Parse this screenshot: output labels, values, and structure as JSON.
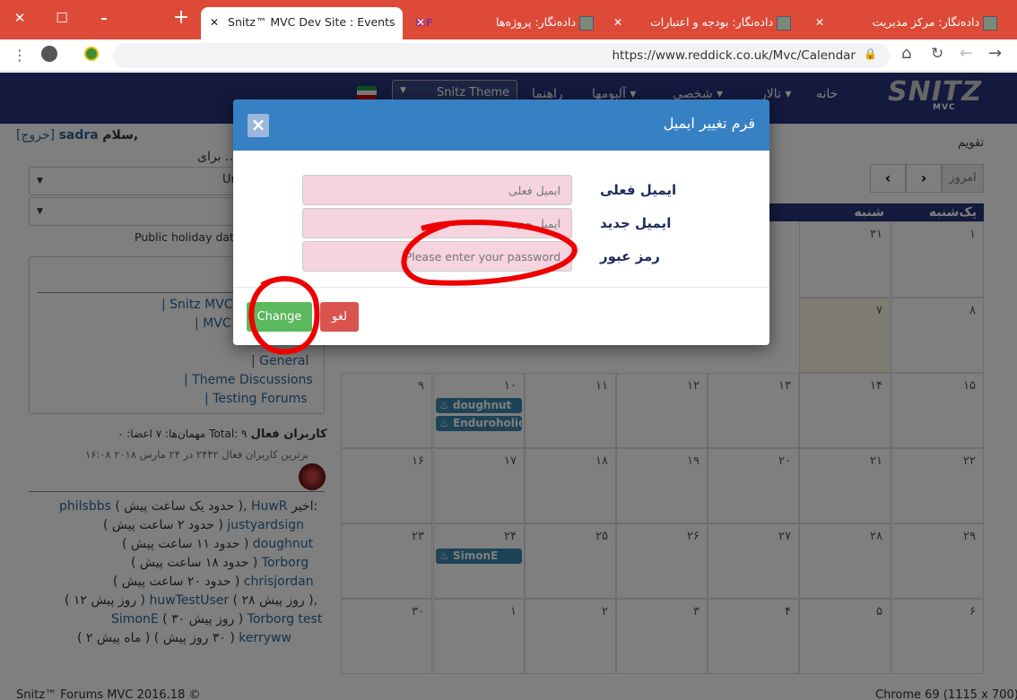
{
  "browser": {
    "tabs": [
      {
        "label": "دادەنگار: مرکز مدیریت"
      },
      {
        "label": "دادەنگار: بودجه و اعتبارات"
      },
      {
        "label": "دادەنگار: پروژه‌ها"
      },
      {
        "label": "Snitz™ MVC Dev Site : Events",
        "badge": "S:F"
      }
    ],
    "new_tab": "+",
    "url": "https://www.reddick.co.uk/Mvc/Calendar"
  },
  "site": {
    "logo": "SNITZ",
    "logo_sub": "MVC",
    "nav": {
      "home": "خانه",
      "forums": "تالار",
      "personal": "شخصی",
      "albums": "آلبومها",
      "guides": "راهنما",
      "theme": "Snitz Theme"
    },
    "greeting": "سلام,",
    "username": "sadra",
    "logout": "[خروج]",
    "calendar_title": "تقویم",
    "filter_label": "برای ..",
    "select1_value": "Un",
    "holiday_text": "Public holiday data",
    "today_btn": "امروز",
    "weekdays": [
      "یک‌شنبه",
      "شنبه"
    ],
    "days": [
      [
        "۱",
        "۳۱"
      ],
      [
        "۸",
        "۷"
      ],
      [
        "۱۵",
        "۱۴",
        "۱۳",
        "۱۲",
        "۱۱",
        "۱۰",
        "۹"
      ],
      [
        "۲۲",
        "۲۱",
        "۲۰",
        "۱۹",
        "۱۸",
        "۱۷",
        "۱۶"
      ],
      [
        "۲۹",
        "۲۸",
        "۲۷",
        "۲۶",
        "۲۵",
        "۲۴",
        "۲۳"
      ],
      [
        "۶",
        "۵",
        "۴",
        "۳",
        "۲",
        "۱",
        "۳۰"
      ]
    ],
    "events": [
      "doughnut",
      "Enduroholic",
      "SimonE"
    ],
    "forums": [
      "Snitz MVC",
      "MVC",
      "General",
      "Theme Discussions",
      "Testing Forums"
    ],
    "active_users": {
      "label": "کاربران فعال",
      "stats": "مهمان‌ها: ۷ اعضا: ۰ Total: ۹",
      "record": "برترین کاربران فعال ۲۴۴۲ در ۲۴ مارس ۲۰۱۸ ۱۶:۰۸"
    },
    "recent_label": "اخیر:",
    "recent": [
      {
        "name": "HuwR",
        "time": "( حدود یک ساعت پیش )"
      },
      {
        "name": "philsbbs",
        "time": ""
      },
      {
        "name": "justyardsign",
        "time": "( حدود ۲ ساعت پیش )"
      },
      {
        "name": "doughnut",
        "time": "( حدود ۱۱ ساعت پیش )"
      },
      {
        "name": "Torborg",
        "time": "( حدود ۱۸ ساعت پیش )"
      },
      {
        "name": "chrisjordan",
        "time": "( حدود ۲۰ ساعت پیش )"
      },
      {
        "name": "huwTestUser",
        "time": "( ۲۸ روز پیش )"
      },
      {
        "name": "Torborg test",
        "time": "( ۳۰ روز پیش )"
      },
      {
        "name": "SimonE",
        "time": "( ۱۲ روز پیش )"
      },
      {
        "name": "kerryww",
        "time": "( ۳۰ روز پیش )"
      }
    ],
    "recent_lines": {
      "l2_time": "( حدود ۲ ساعت پیش )",
      "l3_time": "( حدود ۱۱ ساعت پیش )",
      "l4_time": "( حدود ۱۸ ساعت پیش )",
      "l5_time": "( حدود ۲۰ ساعت پیش )",
      "l6_time1": "( ۲۸ روز پیش )",
      "l6_time2": "( ۱۲ روز پیش )",
      "l7_time": "( ۳۰ روز پیش )",
      "l8_time1": "( ۳۰ روز پیش )",
      "l8_time2": "( ۲ ماه پیش )"
    },
    "footer_left": "Snitz™ Forums MVC 2016.18 ©",
    "footer_right": "Chrome 69 (1115 x 700)"
  },
  "modal": {
    "title": "فرم تغییر ایمیل",
    "close": "×",
    "current_email_label": "ایمیل فعلی",
    "current_email_placeholder": "ایمیل فعلی",
    "new_email_label": "ایمیل جدید",
    "new_email_placeholder": "ایمیل جدید",
    "password_label": "رمز عبور",
    "password_placeholder": "Please enter your password",
    "change_btn": "Change",
    "cancel_btn": "لغو"
  }
}
